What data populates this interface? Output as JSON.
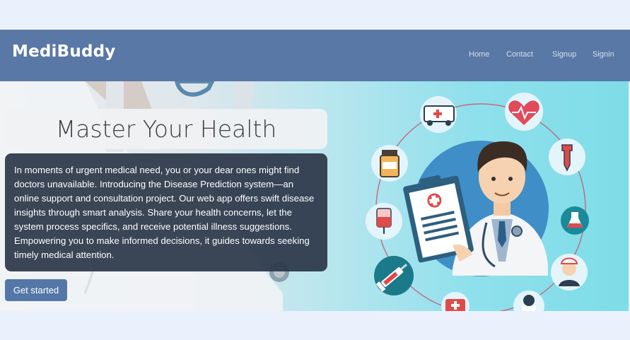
{
  "navbar": {
    "brand": "MediBuddy",
    "links": [
      "Home",
      "Contact",
      "Signup",
      "Signin"
    ]
  },
  "hero": {
    "title": "Master Your Health",
    "description": "In moments of urgent medical need, you or your dear ones might find doctors unavailable. Introducing the Disease Prediction system—an online support and consultation project. Our web app offers swift disease insights through smart analysis. Share your health concerns, let the system process specifics, and receive potential illness suggestions. Empowering you to make informed decisions, it guides towards seeking timely medical attention.",
    "cta_label": "Get started"
  },
  "colors": {
    "navbar": "#5a78a6",
    "page_background": "#eaf1fd",
    "description_panel": "#2a3648",
    "button": "#5577a8"
  },
  "icons": [
    "ambulance-icon",
    "heart-pulse-icon",
    "medicine-bottle-icon",
    "dropper-icon",
    "iv-bag-icon",
    "flask-icon",
    "syringe-icon",
    "nurse-icon",
    "first-aid-kit-icon",
    "doctor-icon",
    "clipboard-icon",
    "stethoscope-icon"
  ]
}
